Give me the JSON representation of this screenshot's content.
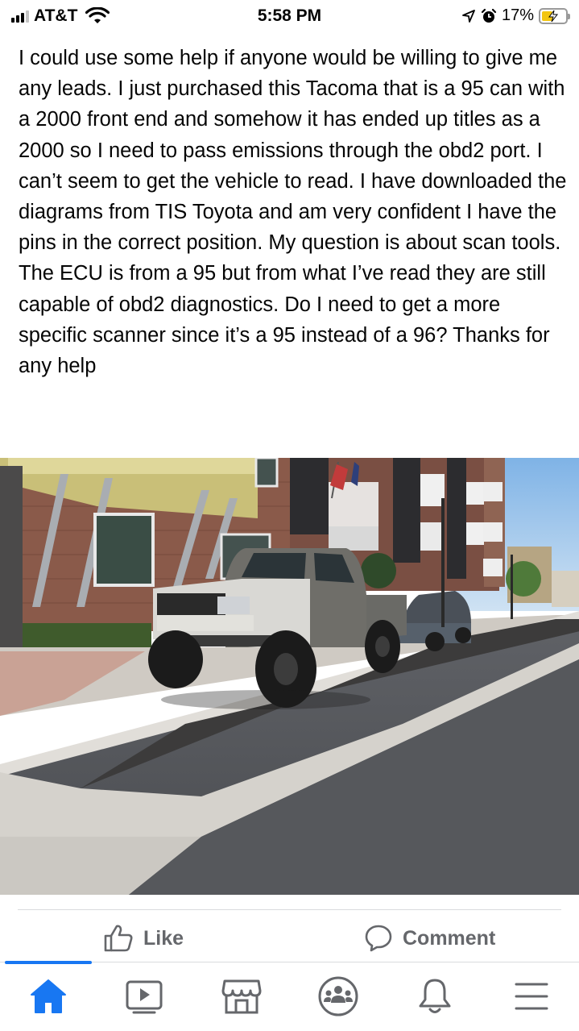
{
  "status_bar": {
    "carrier": "AT&T",
    "time": "5:58 PM",
    "battery_percent": "17%",
    "battery_level": 0.17,
    "signal_bars": 3
  },
  "post": {
    "text": "I could use some help if anyone would be willing to give me any leads. I just purchased this Tacoma that is a 95 can with a 2000 front end and somehow it has ended up titles as a 2000 so I need to pass emissions through the obd2 port. I can’t seem to get the vehicle to read. I have downloaded the diagrams from TIS Toyota and am very confident I have the pins in the correct position. My question is about scan tools. The ECU is from a 95 but from what I’ve read they are still capable of obd2 diagnostics. Do I need to get a more specific scanner since it’s a 95 instead of a 96? Thanks for any help"
  },
  "actions": {
    "like_label": "Like",
    "comment_label": "Comment"
  },
  "bottom_nav": {
    "items": [
      "home-icon",
      "watch-icon",
      "marketplace-icon",
      "groups-icon",
      "notifications-icon",
      "menu-icon"
    ],
    "active": "home-icon"
  },
  "colors": {
    "accent": "#1877f2",
    "action_text": "#65676b",
    "battery_fill": "#f2c511"
  }
}
